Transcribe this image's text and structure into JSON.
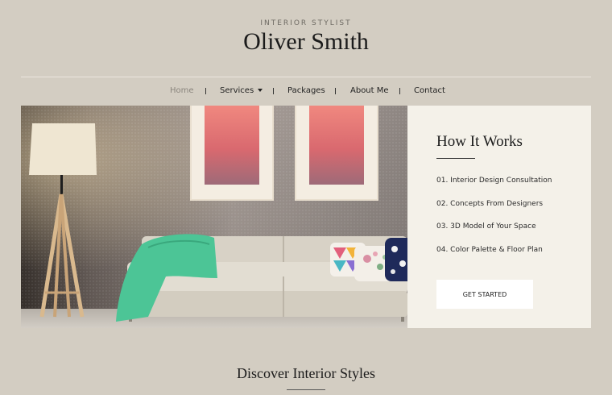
{
  "header": {
    "subtitle": "INTERIOR STYLIST",
    "brand": "Oliver Smith"
  },
  "nav": {
    "items": [
      {
        "label": "Home",
        "active": true
      },
      {
        "label": "Services",
        "has_dropdown": true
      },
      {
        "label": "Packages"
      },
      {
        "label": "About Me"
      },
      {
        "label": "Contact"
      }
    ]
  },
  "hero": {
    "image_alt": "Living room with sofa, floor lamp and framed art"
  },
  "how_it_works": {
    "title": "How It Works",
    "steps": [
      "01. Interior Design Consultation",
      "02. Concepts From Designers",
      "03. 3D Model of Your Space",
      "04. Color Palette & Floor Plan"
    ],
    "cta": "GET STARTED"
  },
  "discover": {
    "title": "Discover Interior Styles"
  },
  "colors": {
    "page_bg": "#d3cdc2",
    "panel_bg": "#f4f1e9",
    "accent_sofa": "#d8d2c6",
    "accent_throw": "#4cc596",
    "art_pink": "#e07a7f"
  }
}
